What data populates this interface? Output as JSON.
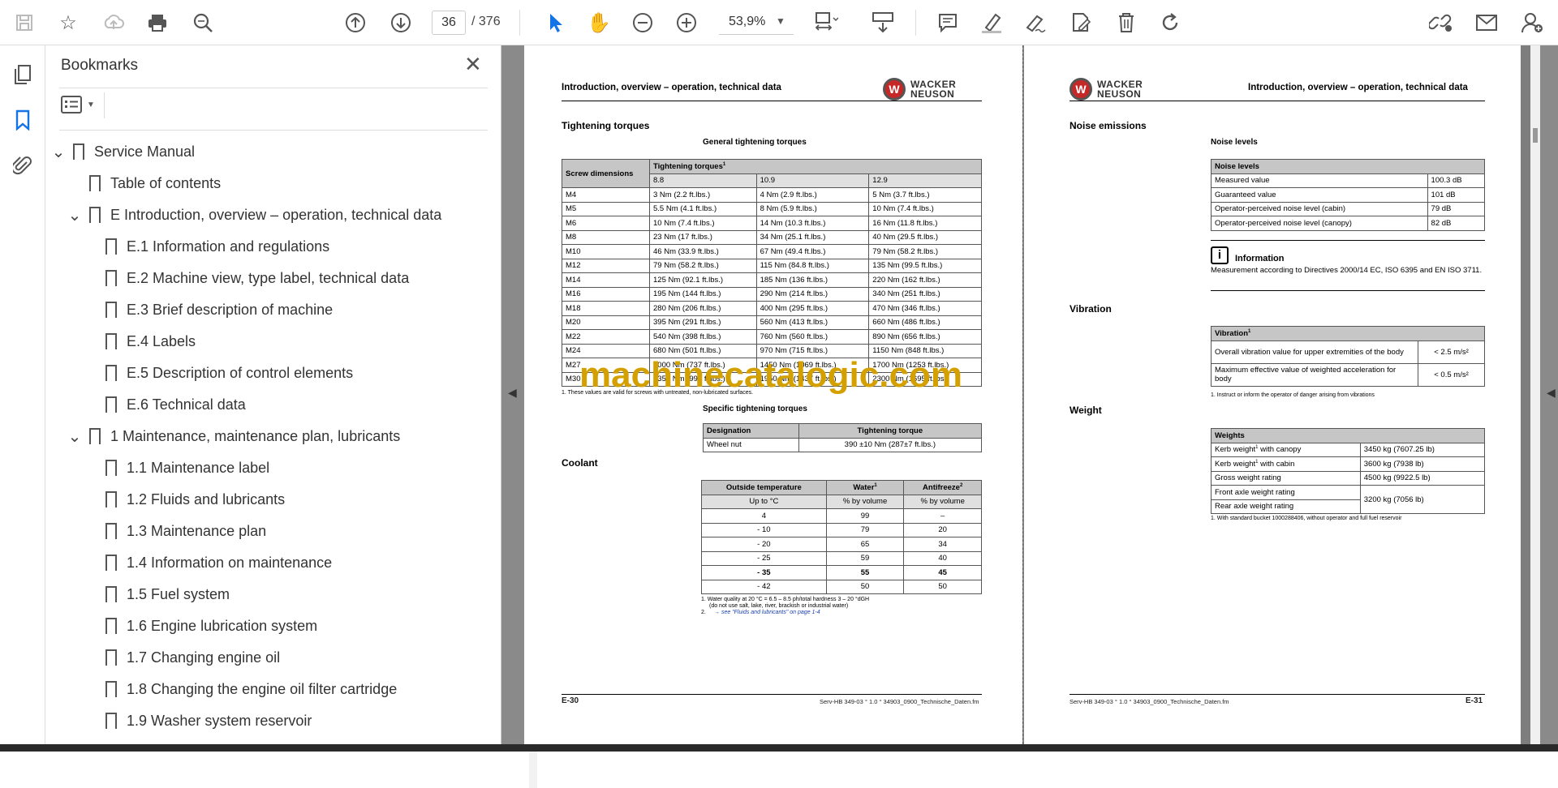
{
  "toolbar": {
    "page_current": "36",
    "page_total": "/ 376",
    "zoom": "53,9%",
    "icons": [
      "save-icon",
      "star-icon",
      "upload-icon",
      "print-icon",
      "zoom-search-icon",
      "page-up-icon",
      "page-down-icon",
      "select-arrow-icon",
      "hand-icon",
      "zoom-out-icon",
      "zoom-in-icon",
      "fit-page-icon",
      "scroll-mode-icon",
      "comment-icon",
      "highlight-icon",
      "sign-icon",
      "edit-pdf-icon",
      "delete-icon",
      "rotate-icon",
      "share-link-icon",
      "mail-icon",
      "add-user-icon"
    ]
  },
  "panel": {
    "title": "Bookmarks",
    "items": [
      {
        "label": "Service Manual",
        "level": 0,
        "expanded": true
      },
      {
        "label": "Table of contents",
        "level": 1,
        "expanded": null
      },
      {
        "label": "E Introduction, overview – operation, technical data",
        "level": 1,
        "expanded": true
      },
      {
        "label": "E.1 Information and regulations",
        "level": 2,
        "expanded": null
      },
      {
        "label": "E.2 Machine view, type label, technical data",
        "level": 2,
        "expanded": null
      },
      {
        "label": "E.3 Brief description of machine",
        "level": 2,
        "expanded": null
      },
      {
        "label": "E.4 Labels",
        "level": 2,
        "expanded": null
      },
      {
        "label": "E.5 Description of control elements",
        "level": 2,
        "expanded": null
      },
      {
        "label": "E.6 Technical data",
        "level": 2,
        "expanded": null
      },
      {
        "label": "1 Maintenance, maintenance plan, lubricants",
        "level": 1,
        "expanded": true
      },
      {
        "label": "1.1 Maintenance label",
        "level": 2,
        "expanded": null
      },
      {
        "label": "1.2 Fluids and lubricants",
        "level": 2,
        "expanded": null
      },
      {
        "label": "1.3 Maintenance plan",
        "level": 2,
        "expanded": null
      },
      {
        "label": "1.4 Information on maintenance",
        "level": 2,
        "expanded": null
      },
      {
        "label": "1.5 Fuel system",
        "level": 2,
        "expanded": null
      },
      {
        "label": "1.6 Engine lubrication system",
        "level": 2,
        "expanded": null
      },
      {
        "label": "1.7 Changing engine oil",
        "level": 2,
        "expanded": null
      },
      {
        "label": "1.8 Changing the engine oil filter cartridge",
        "level": 2,
        "expanded": null
      },
      {
        "label": "1.9 Washer system reservoir",
        "level": 2,
        "expanded": null
      }
    ]
  },
  "left_page": {
    "header": "Introduction, overview – operation, technical data",
    "logo_line1": "WACKER",
    "logo_line2": "NEUSON",
    "section1": "Tightening torques",
    "sub1": "General tightening torques",
    "torque_header_col1": "Screw dimensions",
    "torque_header_col2": "Tightening torques",
    "torque_header_sup": "1",
    "torque_grades": [
      "8.8",
      "10.9",
      "12.9"
    ],
    "torque_rows": [
      [
        "M4",
        "3 Nm (2.2 ft.lbs.)",
        "4 Nm (2.9 ft.lbs.)",
        "5 Nm (3.7 ft.lbs.)"
      ],
      [
        "M5",
        "5.5 Nm (4.1 ft.lbs.)",
        "8 Nm (5.9 ft.lbs.)",
        "10 Nm (7.4 ft.lbs.)"
      ],
      [
        "M6",
        "10 Nm (7.4 ft.lbs.)",
        "14 Nm (10.3 ft.lbs.)",
        "16 Nm (11.8 ft.lbs.)"
      ],
      [
        "M8",
        "23 Nm (17 ft.lbs.)",
        "34 Nm (25.1 ft.lbs.)",
        "40 Nm (29.5 ft.lbs.)"
      ],
      [
        "M10",
        "46 Nm (33.9 ft.lbs.)",
        "67 Nm (49.4 ft.lbs.)",
        "79 Nm (58.2 ft.lbs.)"
      ],
      [
        "M12",
        "79 Nm (58.2 ft.lbs.)",
        "115 Nm (84.8 ft.lbs.)",
        "135 Nm (99.5 ft.lbs.)"
      ],
      [
        "M14",
        "125 Nm (92.1 ft.lbs.)",
        "185 Nm (136 ft.lbs.)",
        "220 Nm (162 ft.lbs.)"
      ],
      [
        "M16",
        "195 Nm (144 ft.lbs.)",
        "290 Nm (214 ft.lbs.)",
        "340 Nm (251 ft.lbs.)"
      ],
      [
        "M18",
        "280 Nm (206 ft.lbs.)",
        "400 Nm (295 ft.lbs.)",
        "470 Nm (346 ft.lbs.)"
      ],
      [
        "M20",
        "395 Nm (291 ft.lbs.)",
        "560 Nm (413 ft.lbs.)",
        "660 Nm (486 ft.lbs.)"
      ],
      [
        "M22",
        "540 Nm (398 ft.lbs.)",
        "760 Nm (560 ft.lbs.)",
        "890 Nm (656 ft.lbs.)"
      ],
      [
        "M24",
        "680 Nm (501 ft.lbs.)",
        "970 Nm (715 ft.lbs.)",
        "1150 Nm (848 ft.lbs.)"
      ],
      [
        "M27",
        "1000 Nm (737 ft.lbs.)",
        "1450 Nm (1069 ft.lbs.)",
        "1700 Nm (1253 ft.lbs.)"
      ],
      [
        "M30",
        "1350 Nm (995 ft.lbs.)",
        "1950 Nm (1437 ft.lbs.)",
        "2300 Nm (1695 ft.lbs.)"
      ]
    ],
    "torque_footnote": "1.    These values are valid for screws with untreated, non-lubricated surfaces.",
    "sub2": "Specific tightening torques",
    "spec_header": [
      "Designation",
      "Tightening torque"
    ],
    "spec_row": [
      "Wheel nut",
      "390 ±10 Nm (287±7 ft.lbs.)"
    ],
    "section2": "Coolant",
    "coolant_header": [
      "Outside temperature",
      "Water",
      "Antifreeze"
    ],
    "coolant_header_sup": [
      "",
      "1",
      "2"
    ],
    "coolant_units": [
      "Up to °C",
      "% by volume",
      "% by volume"
    ],
    "coolant_rows": [
      [
        "4",
        "99",
        "–",
        false
      ],
      [
        "- 10",
        "79",
        "20",
        false
      ],
      [
        "- 20",
        "65",
        "34",
        false
      ],
      [
        "- 25",
        "59",
        "40",
        false
      ],
      [
        "- 35",
        "55",
        "45",
        true
      ],
      [
        "- 42",
        "50",
        "50",
        false
      ]
    ],
    "coolant_foot1": "1.    Water quality at 20 °C = 6.5 – 8.5 ph/total hardness 3 – 20 °dGH",
    "coolant_foot1b": "(do not use salt, lake, river, brackish or industrial water)",
    "coolant_foot2a": "2.",
    "coolant_foot2b": "→ see \"Fluids and lubricants\" on page 1-4",
    "page_no": "E-30",
    "file_name": "Serv-HB 349-03 ° 1.0 ° 34903_0900_Technische_Daten.fm"
  },
  "right_page": {
    "header": "Introduction, overview – operation, technical data",
    "logo_line1": "WACKER",
    "logo_line2": "NEUSON",
    "section1": "Noise emissions",
    "sub1": "Noise levels",
    "noise_header": "Noise levels",
    "noise_rows": [
      [
        "Measured value",
        "100.3 dB"
      ],
      [
        "Guaranteed value",
        "101 dB"
      ],
      [
        "Operator-perceived noise level (cabin)",
        "79 dB"
      ],
      [
        "Operator-perceived noise level (canopy)",
        "82 dB"
      ]
    ],
    "info_title": "Information",
    "info_text": "Measurement according to Directives 2000/14 EC, ISO 6395 and EN ISO 3711.",
    "section2": "Vibration",
    "vib_header": "Vibration",
    "vib_header_sup": "1",
    "vib_rows": [
      [
        "Overall vibration value for upper extremities of the body",
        "< 2.5 m/s²"
      ],
      [
        "Maximum effective value of weighted acceleration for body",
        "< 0.5 m/s²"
      ]
    ],
    "vib_footnote": "1.    Instruct or inform the operator of danger arising from vibrations",
    "section3": "Weight",
    "weight_header": "Weights",
    "weight_rows": [
      [
        "Kerb weight",
        "1",
        " with canopy",
        "3450 kg (7607.25 lb)"
      ],
      [
        "Kerb weight",
        "1",
        " with cabin",
        "3600 kg (7938 lb)"
      ],
      [
        "Gross weight rating",
        "",
        "",
        "4500 kg (9922.5 lb)"
      ],
      [
        "Front axle weight rating",
        "",
        "",
        "3200 kg (7056 lb)"
      ],
      [
        "Rear axle weight rating",
        "",
        "",
        ""
      ]
    ],
    "weight_footnote": "1.    With standard bucket 1000288406, without operator and full fuel reservoir",
    "page_no": "E-31",
    "file_name": "Serv-HB 349-03 ° 1.0 ° 34903_0900_Technische_Daten.fm"
  },
  "watermark": "machinecatalogic.com"
}
